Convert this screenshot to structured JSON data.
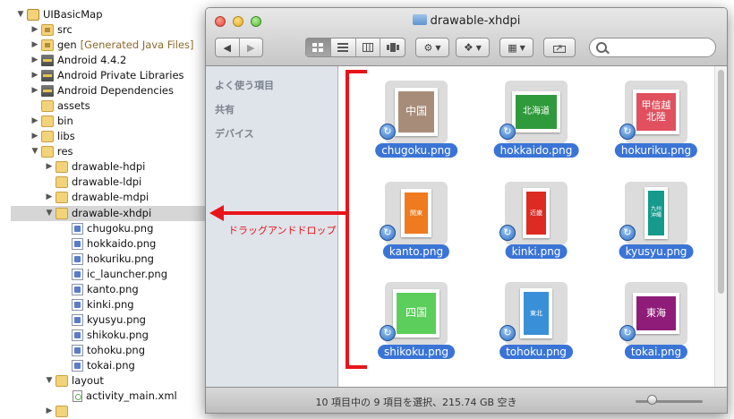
{
  "explorer": {
    "rows": [
      {
        "label": "UIBasicMap",
        "annot": ""
      },
      {
        "label": "src",
        "annot": ""
      },
      {
        "label": "gen",
        "annot": "[Generated Java Files]"
      },
      {
        "label": "Android 4.4.2",
        "annot": ""
      },
      {
        "label": "Android Private Libraries",
        "annot": ""
      },
      {
        "label": "Android Dependencies",
        "annot": ""
      },
      {
        "label": "assets",
        "annot": ""
      },
      {
        "label": "bin",
        "annot": ""
      },
      {
        "label": "libs",
        "annot": ""
      },
      {
        "label": "res",
        "annot": ""
      },
      {
        "label": "drawable-hdpi",
        "annot": ""
      },
      {
        "label": "drawable-ldpi",
        "annot": ""
      },
      {
        "label": "drawable-mdpi",
        "annot": ""
      },
      {
        "label": "drawable-xhdpi",
        "annot": ""
      },
      {
        "label": "chugoku.png",
        "annot": ""
      },
      {
        "label": "hokkaido.png",
        "annot": ""
      },
      {
        "label": "hokuriku.png",
        "annot": ""
      },
      {
        "label": "ic_launcher.png",
        "annot": ""
      },
      {
        "label": "kanto.png",
        "annot": ""
      },
      {
        "label": "kinki.png",
        "annot": ""
      },
      {
        "label": "kyusyu.png",
        "annot": ""
      },
      {
        "label": "shikoku.png",
        "annot": ""
      },
      {
        "label": "tohoku.png",
        "annot": ""
      },
      {
        "label": "tokai.png",
        "annot": ""
      },
      {
        "label": "layout",
        "annot": ""
      },
      {
        "label": "activity_main.xml",
        "annot": ""
      }
    ],
    "selected_item": "drawable-xhdpi"
  },
  "finder": {
    "title": "drawable-xhdpi",
    "sidebar_headers": [
      "よく使う項目",
      "共有",
      "デバイス"
    ],
    "files": [
      {
        "label": "chugoku.png",
        "thumb_text": "中国",
        "color": "#a88c7a"
      },
      {
        "label": "hokkaido.png",
        "thumb_text": "北海道",
        "color": "#2f9a3b"
      },
      {
        "label": "hokuriku.png",
        "thumb_text": "甲信越\n北陸",
        "color": "#e0505e"
      },
      {
        "label": "kanto.png",
        "thumb_text": "関東",
        "color": "#ef7a1f"
      },
      {
        "label": "kinki.png",
        "thumb_text": "近畿",
        "color": "#dd2a22"
      },
      {
        "label": "kyusyu.png",
        "thumb_text": "九州\n沖縄",
        "color": "#159a8c"
      },
      {
        "label": "shikoku.png",
        "thumb_text": "四国",
        "color": "#5cce5c"
      },
      {
        "label": "tohoku.png",
        "thumb_text": "東北",
        "color": "#3a8fd9"
      },
      {
        "label": "tokai.png",
        "thumb_text": "東海",
        "color": "#8f1c78"
      }
    ],
    "status": "10 項目中の 9 項目を選択、215.74 GB 空き"
  },
  "annotation": {
    "text": "ドラッグアンドドロップ",
    "color": "#e8141a"
  }
}
